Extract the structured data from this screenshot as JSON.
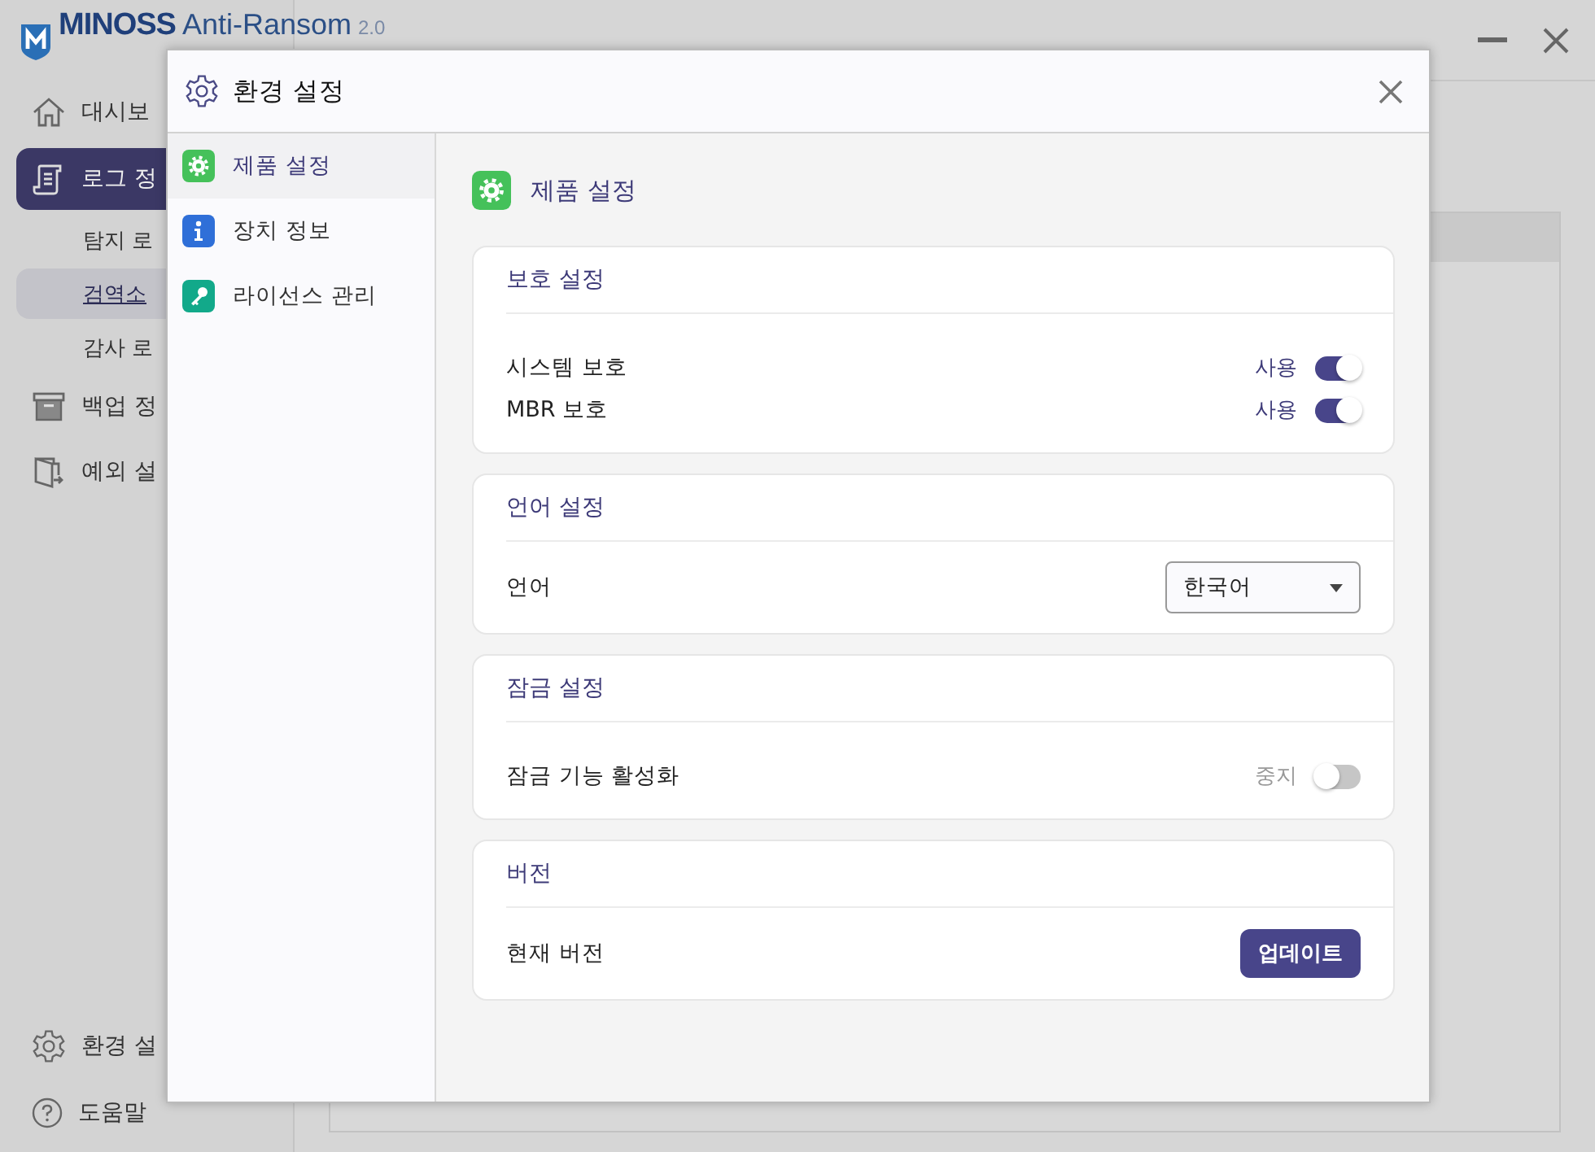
{
  "app": {
    "logo": {
      "brand": "MINOSS",
      "product": "Anti-Ransom",
      "version": "2.0"
    }
  },
  "sidebar": {
    "items": [
      {
        "label": "대시보",
        "selected": false
      },
      {
        "label": "로그 정",
        "selected": true,
        "children": [
          {
            "label": "탐지 로",
            "selected": false
          },
          {
            "label": "검역소",
            "selected": true
          },
          {
            "label": "감사 로",
            "selected": false
          }
        ]
      },
      {
        "label": "백업 정",
        "selected": false
      },
      {
        "label": "예외 설",
        "selected": false
      }
    ],
    "bottom_items": [
      {
        "label": "환경 설"
      },
      {
        "label": "도움말"
      }
    ]
  },
  "dialog": {
    "title": "환경 설정",
    "nav": [
      {
        "label": "제품 설정",
        "selected": true
      },
      {
        "label": "장치 정보",
        "selected": false
      },
      {
        "label": "라이선스 관리",
        "selected": false
      }
    ],
    "page_title": "제품 설정",
    "sections": [
      {
        "title": "보호 설정",
        "rows": [
          {
            "kind": "toggle",
            "label": "시스템 보호",
            "state_label": "사용",
            "on": true
          },
          {
            "kind": "toggle",
            "label": "MBR 보호",
            "state_label": "사용",
            "on": true
          }
        ]
      },
      {
        "title": "언어 설정",
        "rows": [
          {
            "kind": "select",
            "label": "언어",
            "value": "한국어"
          }
        ]
      },
      {
        "title": "잠금 설정",
        "rows": [
          {
            "kind": "toggle",
            "label": "잠금 기능 활성화",
            "state_label": "중지",
            "on": false
          }
        ]
      },
      {
        "title": "버전",
        "rows": [
          {
            "kind": "button",
            "label": "현재 버전",
            "button": "업데이트"
          }
        ]
      }
    ]
  }
}
